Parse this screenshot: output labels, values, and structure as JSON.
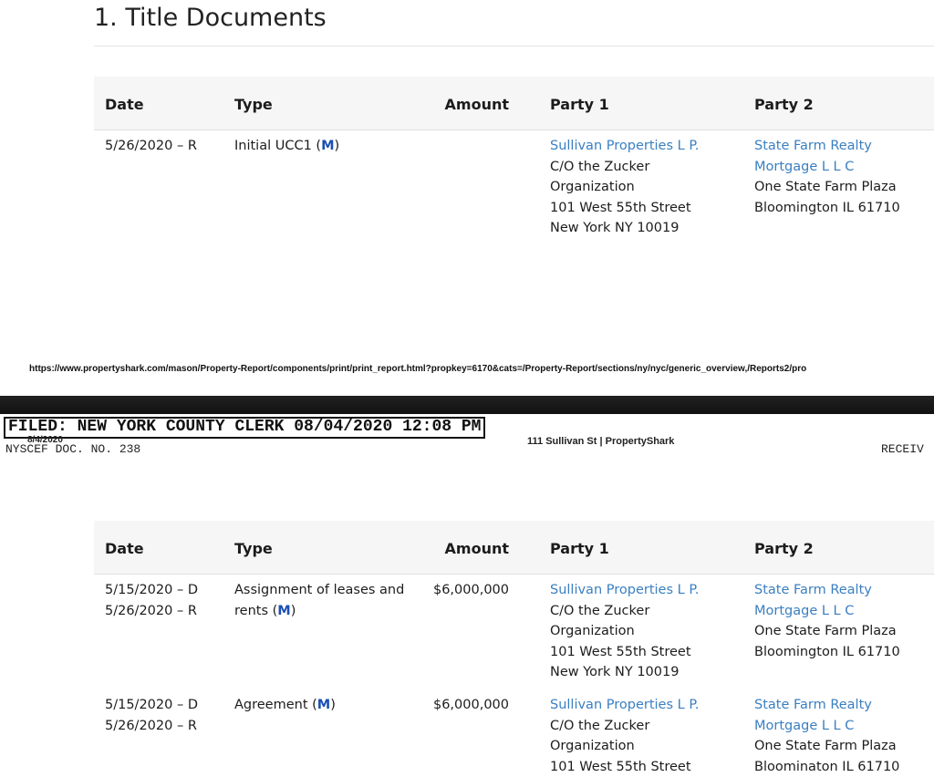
{
  "section": {
    "title": "1. Title Documents"
  },
  "columns": {
    "date": "Date",
    "type": "Type",
    "amount": "Amount",
    "party1": "Party 1",
    "party2": "Party 2"
  },
  "table1": {
    "rows": [
      {
        "date_lines": [
          "5/26/2020 – R"
        ],
        "type_text": "Initial UCC1 (",
        "type_link": "M",
        "type_close": ")",
        "amount": "",
        "party1_link": "Sullivan Properties L P.",
        "party1_lines": [
          "C/O the Zucker",
          "Organization",
          "101 West 55th Street",
          "New York NY 10019"
        ],
        "party2_link": "State Farm Realty Mortgage L L C",
        "party2_lines": [
          "One State Farm Plaza",
          "Bloomington IL 61710"
        ]
      }
    ]
  },
  "print_footer": {
    "url": "https://www.propertyshark.com/mason/Property-Report/components/print/print_report.html?propkey=6170&cats=/Property-Report/sections/ny/nyc/generic_overview,/Reports2/pro"
  },
  "filing": {
    "stamp": "FILED: NEW YORK COUNTY CLERK 08/04/2020 12:08 PM",
    "print_date": "8/4/2020",
    "doc_no": "NYSCEF DOC. NO. 238",
    "page_header": "111 Sullivan St | PropertyShark",
    "received": "RECEIV"
  },
  "table2": {
    "rows": [
      {
        "date_lines": [
          "5/15/2020 – D",
          "5/26/2020 – R"
        ],
        "type_text": "Assignment of leases and rents (",
        "type_link": "M",
        "type_close": ")",
        "amount": "$6,000,000",
        "party1_link": "Sullivan Properties L P.",
        "party1_lines": [
          "C/O the Zucker",
          "Organization",
          "101 West 55th Street",
          "New York NY 10019"
        ],
        "party2_link": "State Farm Realty Mortgage L L C",
        "party2_lines": [
          "One State Farm Plaza",
          "Bloomington IL 61710"
        ]
      },
      {
        "date_lines": [
          "5/15/2020 – D",
          "5/26/2020 – R"
        ],
        "type_text": "Agreement (",
        "type_link": "M",
        "type_close": ")",
        "amount": "$6,000,000",
        "party1_link": "Sullivan Properties L P.",
        "party1_lines": [
          "C/O the Zucker",
          "Organization",
          "101 West 55th Street"
        ],
        "party2_link": "State Farm Realty Mortgage L L C",
        "party2_lines": [
          "One State Farm Plaza",
          "Bloominaton IL 61710"
        ]
      }
    ]
  }
}
